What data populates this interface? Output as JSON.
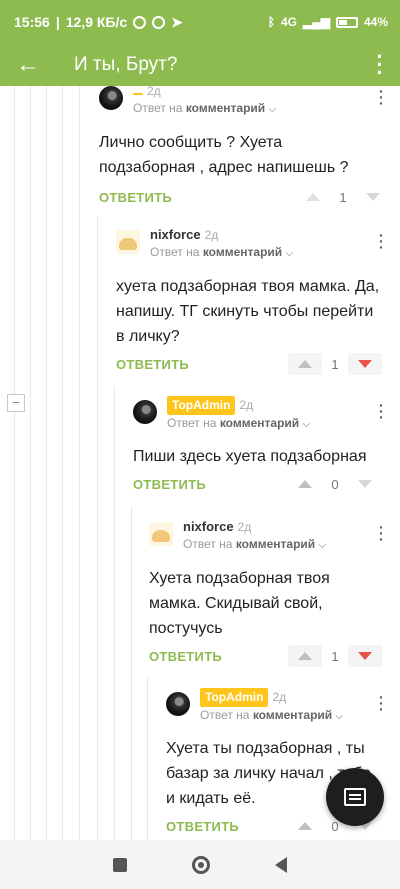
{
  "status": {
    "time": "15:56",
    "speed": "12,9 КБ/с",
    "network": "4G",
    "battery": "44%"
  },
  "appbar": {
    "title": "И ты, Брут?"
  },
  "labels": {
    "reply_to": "Ответ на",
    "comment": "комментарий",
    "answer": "ОТВЕТИТЬ"
  },
  "comments": [
    {
      "author": "",
      "age": "2д",
      "text": "Лично сообщить ? Хуета подзаборная , адрес напишешь ?",
      "score": "1",
      "downvoted": false
    },
    {
      "author": "nixforce",
      "age": "2д",
      "text": "хуета подзаборная твоя мамка. Да, напишу. ТГ скинуть чтобы перейти в личку?",
      "score": "1",
      "downvoted": true
    },
    {
      "author": "TopAdmin",
      "age": "2д",
      "text": "Пиши здесь хуета подзаборная",
      "score": "0",
      "downvoted": false
    },
    {
      "author": "nixforce",
      "age": "2д",
      "text": "Хуета подзаборная твоя мамка. Скидывай свой, постучусь",
      "score": "1",
      "downvoted": true
    },
    {
      "author": "TopAdmin",
      "age": "2д",
      "text": "Хуета ты подзаборная , ты базар за личку начал , тебе и кидать её.",
      "score": "0",
      "downvoted": false
    }
  ],
  "colors": {
    "accent": "#8dbb4f",
    "badge": "#ffc51a",
    "downvote": "#e8534a"
  }
}
